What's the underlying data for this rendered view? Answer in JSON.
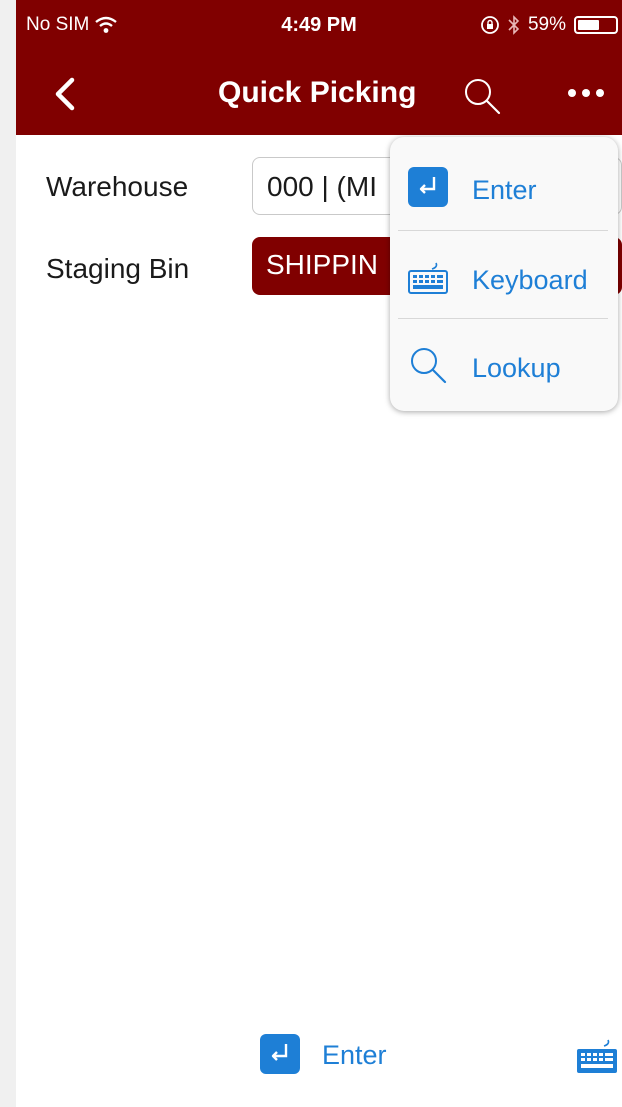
{
  "status_bar": {
    "carrier": "No SIM",
    "time": "4:49 PM",
    "battery": "59%",
    "battery_level": 0.59,
    "icons": [
      "wifi-icon",
      "orientation-lock-icon",
      "bluetooth-icon",
      "battery-icon"
    ]
  },
  "nav": {
    "title": "Quick Picking",
    "icons": [
      "back-chevron-icon",
      "search-icon",
      "more-icon"
    ]
  },
  "form": {
    "warehouse_label": "Warehouse",
    "warehouse_value": "000 | (MI",
    "staging_label": "Staging Bin",
    "staging_value": "SHIPPIN"
  },
  "menu": {
    "items": [
      {
        "label": "Enter",
        "icon": "enter-icon"
      },
      {
        "label": "Keyboard",
        "icon": "keyboard-icon"
      },
      {
        "label": "Lookup",
        "icon": "search-icon"
      }
    ]
  },
  "bottom_toolbar": {
    "enter_label": "Enter",
    "icons": [
      "enter-icon",
      "keyboard-icon"
    ]
  },
  "colors": {
    "brand": "#800000",
    "accent": "#1e7fd6",
    "background": "#ffffff"
  }
}
